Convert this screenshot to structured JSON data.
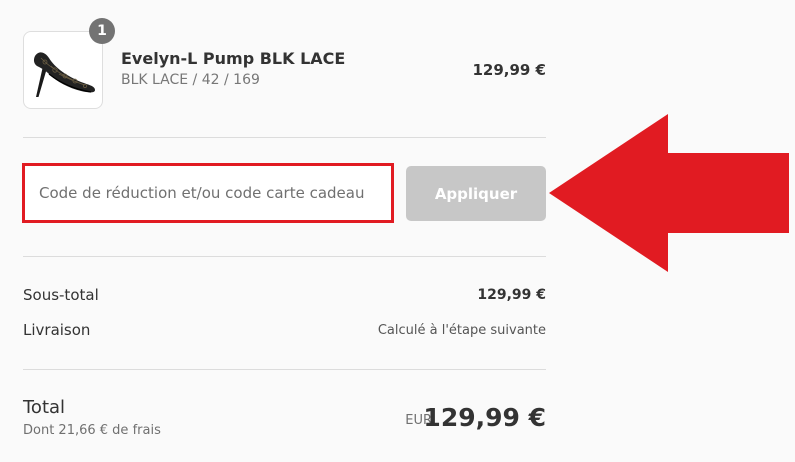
{
  "product": {
    "quantity": "1",
    "title": "Evelyn-L Pump BLK LACE",
    "variant": "BLK LACE / 42 / 169",
    "price": "129,99 €",
    "image_icon": "shoe-pump-icon"
  },
  "discount": {
    "placeholder": "Code de réduction et/ou code carte cadeau",
    "value": "",
    "apply_label": "Appliquer"
  },
  "summary": {
    "subtotal_label": "Sous-total",
    "subtotal_value": "129,99 €",
    "shipping_label": "Livraison",
    "shipping_value": "Calculé à l'étape suivante"
  },
  "total": {
    "label": "Total",
    "taxes_note": "Dont 21,66 € de frais",
    "currency_code": "EUR",
    "amount": "129,99 €"
  },
  "colors": {
    "highlight_red": "#e11b22",
    "apply_button_bg": "#c7c7c7",
    "badge_bg": "#737373"
  },
  "annotation": {
    "arrow_icon": "red-arrow-left-icon"
  }
}
